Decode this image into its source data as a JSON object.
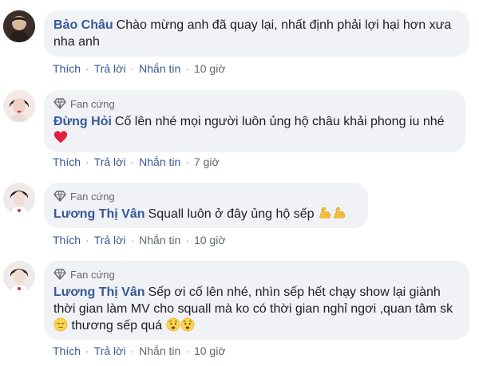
{
  "comments": [
    {
      "author": "Bảo Châu",
      "text": "Chào mừng anh đã quay lại, nhất định phải lợi hại hơn xưa nha anh",
      "fan_badge": "",
      "actions": {
        "like": "Thích",
        "reply": "Trả lời",
        "message": "Nhắn tin",
        "time": "10 giờ"
      }
    },
    {
      "author": "Đừng Hỏi",
      "text": "Cố lên nhé mọi người luôn ủng hộ châu khải phong iu nhé",
      "fan_badge": "Fan cứng",
      "emoji_after": [
        "red-heart"
      ],
      "actions": {
        "like": "Thích",
        "reply": "Trả lời",
        "message": "Nhắn tin",
        "time": "7 giờ"
      }
    },
    {
      "author": "Lương Thị Vân",
      "text": "Squall luôn ở đây ủng hộ sếp",
      "fan_badge": "Fan cứng",
      "emoji_after": [
        "flexed-biceps",
        "flexed-biceps"
      ],
      "actions": {
        "like": "Thích",
        "reply": "Trả lời",
        "message": "Nhắn tin",
        "time": "10 giờ"
      }
    },
    {
      "author": "Lương Thị Vân",
      "text_part1": "Sếp ơi cố lên nhé, nhìn sếp hết chạy show lại giành thời gian làm MV cho squall mà ko có thời gian nghỉ ngơi ,quan tâm sk",
      "text_part2": "thương sếp quá",
      "fan_badge": "Fan cứng",
      "emoji_mid": [
        "pensive-face"
      ],
      "emoji_after": [
        "worried-face",
        "worried-face"
      ],
      "actions": {
        "like": "Thích",
        "reply": "Trả lời",
        "message": "Nhắn tin",
        "time": "10 giờ"
      }
    }
  ],
  "colors": {
    "author": "#365899",
    "bubble": "#f0f2f5",
    "action_link": "#385898",
    "muted": "#616770"
  }
}
